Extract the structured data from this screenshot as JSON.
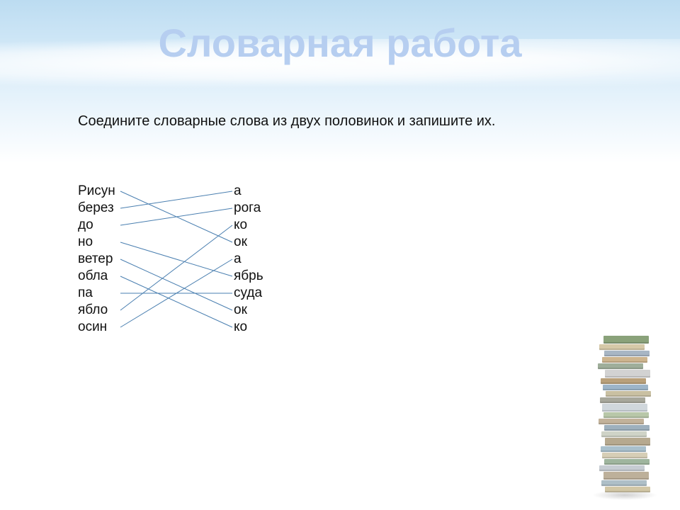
{
  "title": "Словарная работа",
  "instruction": "Соедините словарные слова из двух половинок и запишите их.",
  "left": [
    "Рисун",
    "берез",
    "до",
    "но",
    "ветер",
    "обла",
    "па",
    "ябло",
    "осин"
  ],
  "right": [
    "а",
    "рога",
    "ко",
    "ок",
    "а",
    "ябрь",
    "суда",
    "ок",
    "ко"
  ],
  "connections": [
    [
      0,
      3
    ],
    [
      1,
      0
    ],
    [
      2,
      1
    ],
    [
      3,
      5
    ],
    [
      4,
      7
    ],
    [
      5,
      8
    ],
    [
      6,
      6
    ],
    [
      7,
      2
    ],
    [
      8,
      4
    ]
  ],
  "book_colors": [
    "#8aa27a",
    "#d6c9a8",
    "#a8b6c4",
    "#cdb48e",
    "#9fae9a",
    "#d2d2d2",
    "#b9a07a",
    "#9db5c9",
    "#c9c0a2",
    "#a7a79b",
    "#d0d7dc",
    "#b8c7a8",
    "#c2b29a",
    "#9eb0bd",
    "#cfd3c7",
    "#b6a98f",
    "#a9c0cc",
    "#d6ceb6",
    "#9fb59e",
    "#c6ccd2",
    "#bdb09a",
    "#aebfc7",
    "#d2c7a6"
  ]
}
